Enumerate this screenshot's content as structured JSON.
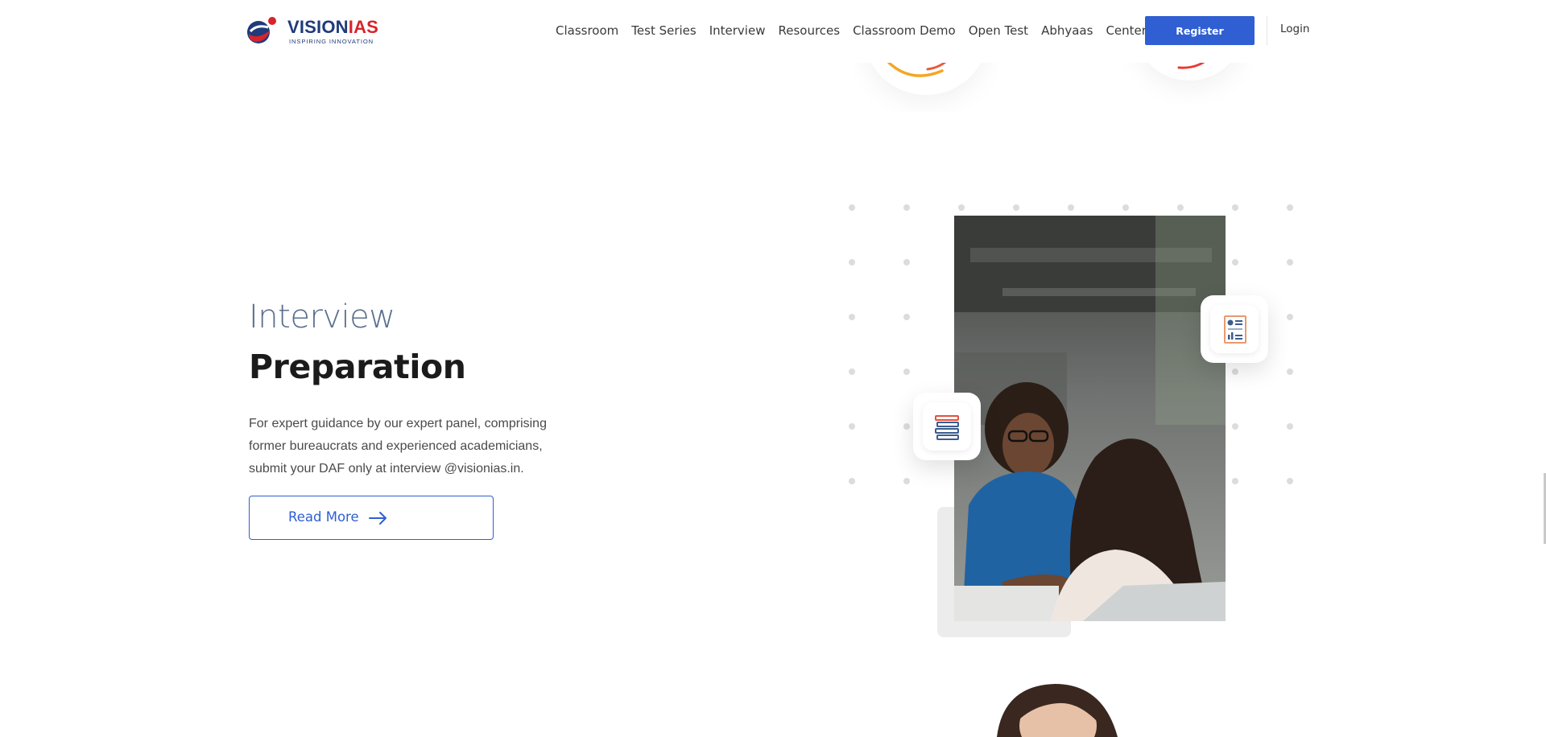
{
  "header": {
    "logo": {
      "title_main": "VISION",
      "title_accent": "IAS",
      "tagline": "INSPIRING INNOVATION"
    },
    "nav_items": [
      {
        "label": "Classroom"
      },
      {
        "label": "Test Series"
      },
      {
        "label": "Interview"
      },
      {
        "label": "Resources"
      },
      {
        "label": "Classroom Demo"
      },
      {
        "label": "Open Test"
      },
      {
        "label": "Abhyaas"
      },
      {
        "label": "Centers"
      }
    ],
    "register_label": "Register",
    "login_label": "Login"
  },
  "section": {
    "heading_light": "Interview",
    "heading_bold": "Preparation",
    "description": "For expert guidance by our expert panel, comprising former bureaucrats and experienced academicians, submit your DAF only at interview @visionias.in.",
    "read_more_label": "Read More"
  },
  "colors": {
    "brand_blue": "#2f5fd2",
    "logo_navy": "#1f3b7a",
    "logo_red": "#d8232a"
  },
  "icons": {
    "read_more": "arrow-right-icon",
    "card_left": "books-icon",
    "card_right": "report-icon"
  }
}
